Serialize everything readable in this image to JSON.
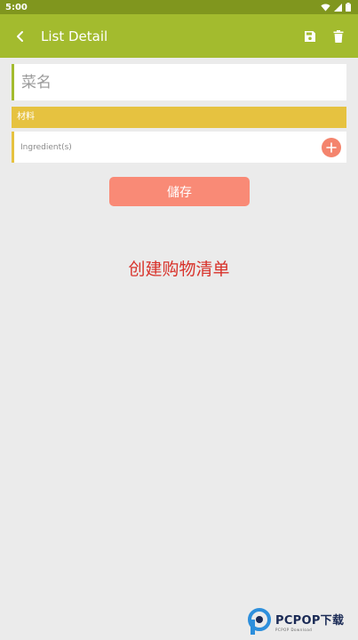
{
  "status_bar": {
    "time": "5:00",
    "icons": [
      "wifi-icon",
      "signal-icon",
      "battery-icon"
    ]
  },
  "app_bar": {
    "title": "List Detail",
    "back_icon": "chevron-left-icon",
    "save_icon": "floppy-disk-icon",
    "delete_icon": "trash-icon"
  },
  "dish": {
    "value": "",
    "placeholder": "菜名"
  },
  "materials": {
    "label": "材料"
  },
  "ingredient": {
    "value": "",
    "placeholder": "Ingredient(s)",
    "add_icon": "plus-circle-icon"
  },
  "save_button": {
    "label": "儲存"
  },
  "create_label": "创建购物清单",
  "watermark": {
    "brand": "PCPOP下载",
    "sub": "PCPOP Download"
  },
  "colors": {
    "status_bar": "#80961e",
    "app_bar": "#a3bb2e",
    "materials_bar": "#e6c240",
    "save_button": "#f98a76",
    "add_button": "#f4846d",
    "create_label": "#d8322a",
    "background": "#ebebeb"
  }
}
